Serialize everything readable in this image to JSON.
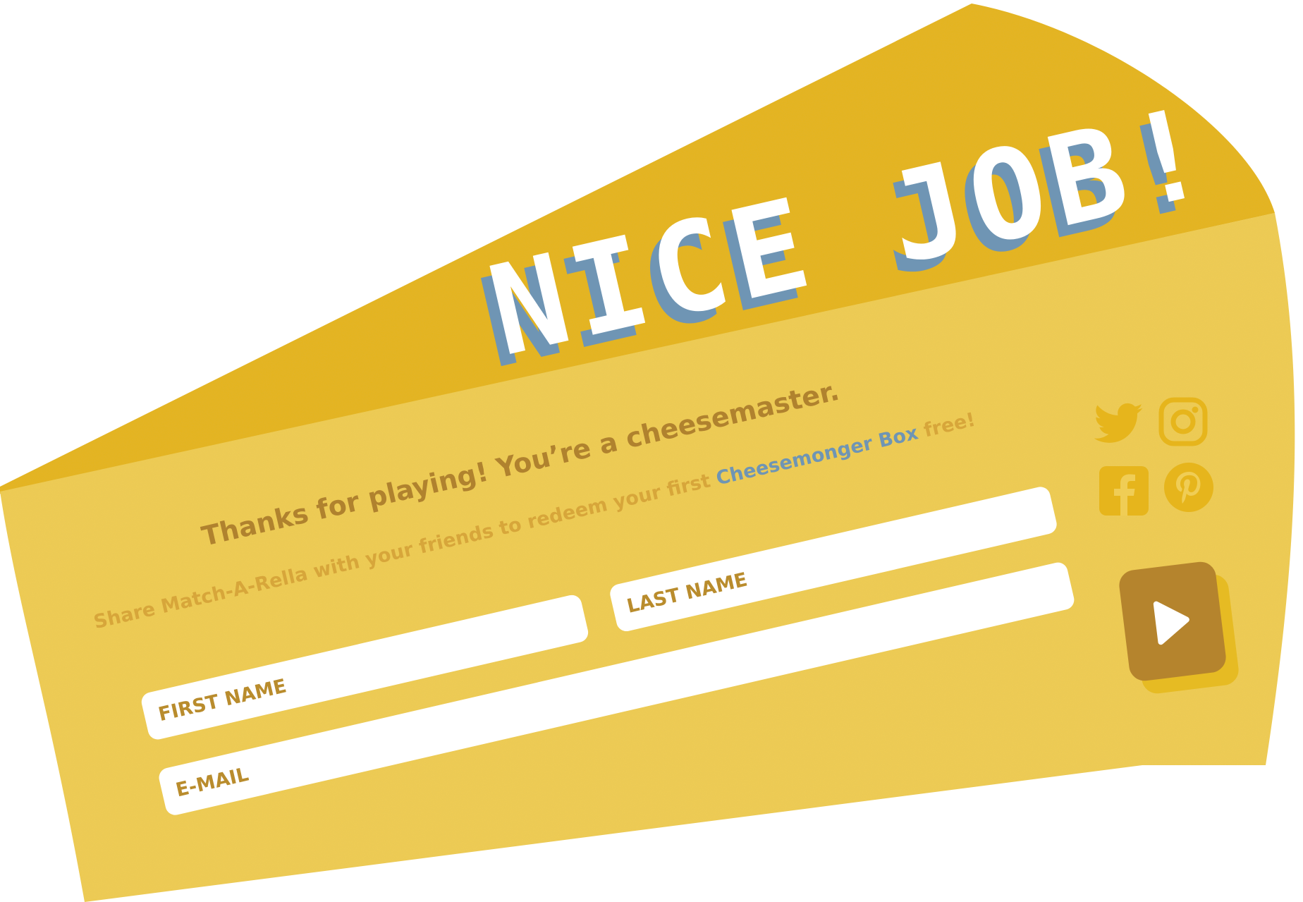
{
  "dialog": {
    "title": "NICE JOB!",
    "thanks": "Thanks for playing! You’re a cheesemaster.",
    "share_prefix": "Share Match-A-Rella with your friends to redeem your first ",
    "share_brand": "Cheesemonger Box",
    "share_suffix": " free!"
  },
  "form": {
    "first_name_placeholder": "FIRST NAME",
    "last_name_placeholder": "LAST NAME",
    "email_placeholder": "E-MAIL",
    "submit_icon": "play-icon"
  },
  "social": {
    "icons": [
      "twitter-icon",
      "instagram-icon",
      "facebook-icon",
      "pinterest-icon"
    ]
  },
  "colors": {
    "wedge_top": "#e6b51c",
    "wedge_body": "#f0cd55",
    "title_shadow": "#6f95b4",
    "text_brown": "#b0822e",
    "link_blue": "#6f95b4",
    "button": "#b5842d"
  }
}
